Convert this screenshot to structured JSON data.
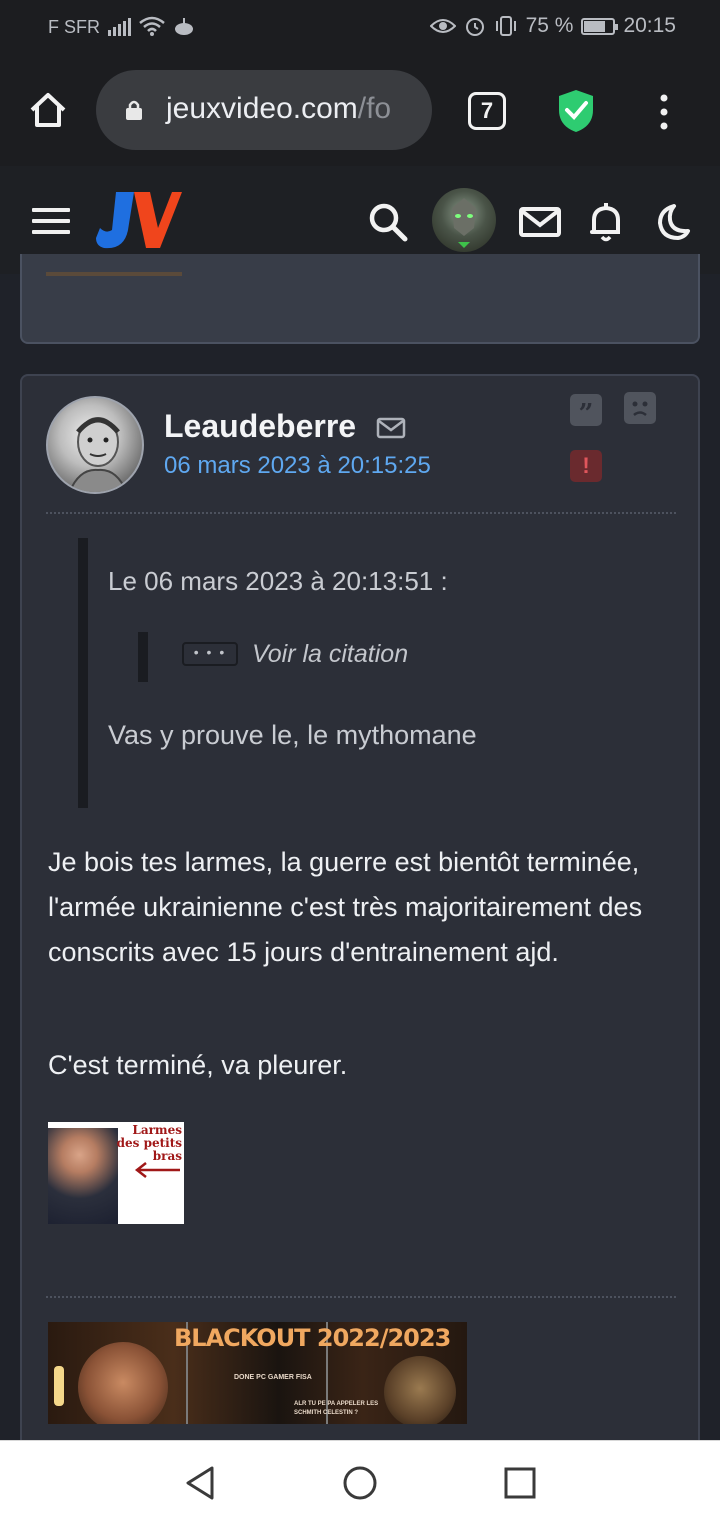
{
  "status_bar": {
    "carrier": "F SFR",
    "battery": "75 %",
    "battery_level": 0.75,
    "time": "20:15"
  },
  "browser": {
    "url_main": "jeuxvideo.com",
    "url_rest": "/fo",
    "tab_count": "7",
    "icons": [
      "home-icon",
      "lock-icon",
      "tabs-icon",
      "adblock-shield-icon",
      "more-vert-icon"
    ]
  },
  "site_header": {
    "logo": "JV",
    "icons": [
      "menu-icon",
      "search-icon",
      "user-avatar",
      "mail-icon",
      "bell-icon",
      "moon-icon"
    ]
  },
  "post": {
    "author": "Leaudeberre",
    "date": "06 mars 2023 à 20:15:25",
    "quote_header": "Le 06 mars 2023 à 20:13:51 :",
    "nested_quote_dots": "• • •",
    "nested_quote_label": "Voir la citation",
    "quote_text": "Vas y prouve le, le mythomane",
    "body_paragraph_1": "Je bois tes larmes, la guerre est bientôt terminée, l'armée ukrainienne c'est très majoritairement des conscrits avec 15 jours d'entrainement ajd.",
    "body_paragraph_2": "C'est terminé, va pleurer.",
    "sticker_text": "Larmes des petits bras",
    "signature": {
      "title": "BLACKOUT 2022/2023",
      "line1": "DONE PC GAMER FISA",
      "line2": "ALR TU PE PA APPELER LES SCHMITH CELESTIN ?"
    },
    "colors": {
      "card_bg": "#2c2f38",
      "date_link": "#5fa8f0",
      "report": "#e0565c"
    }
  },
  "nav_bar": {
    "icons": [
      "back-icon",
      "home-circle-icon",
      "recents-icon"
    ]
  }
}
